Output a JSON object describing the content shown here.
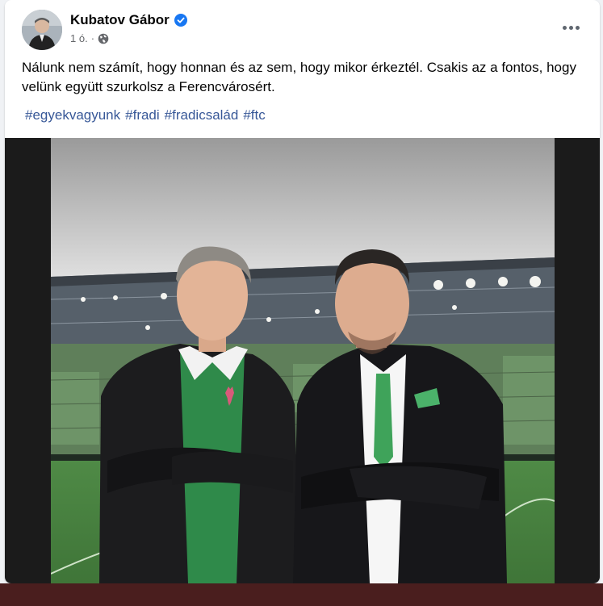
{
  "post": {
    "author": "Kubatov Gábor",
    "timestamp": "1 ó.",
    "separator": "·",
    "visibility_icon": "globe-icon",
    "verified_icon": "verified-badge-icon",
    "more_icon": "more-options-icon",
    "text": "Nálunk nem számít, hogy honnan és az sem, hogy mikor érkeztél. Csakis az a fontos, hogy velünk együtt szurkolsz a Ferencvárosért.",
    "hashtags": [
      "#egyekvagyunk",
      "#fradi",
      "#fradicsalád",
      "#ftc"
    ]
  },
  "colors": {
    "verified_blue": "#1877f2",
    "hashtag_blue": "#385898",
    "page_bg": "#f0f2f5",
    "card_bg": "#ffffff"
  }
}
